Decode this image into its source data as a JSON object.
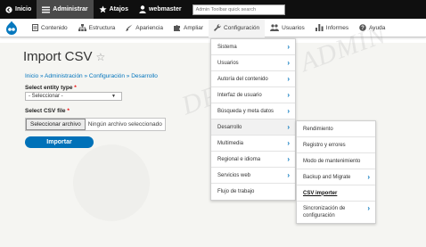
{
  "toolbar": {
    "home": "Inicio",
    "manage": "Administrar",
    "shortcuts": "Atajos",
    "user": "webmaster",
    "search_placeholder": "Admin Toolbar quick search"
  },
  "tray": {
    "items": [
      "Contenido",
      "Estructura",
      "Apariencia",
      "Ampliar",
      "Configuración",
      "Usuarios",
      "Informes",
      "Ayuda"
    ]
  },
  "page": {
    "title": "Import CSV",
    "breadcrumb": "Inicio » Administración » Configuración » Desarrollo",
    "entity_label": "Select entity type",
    "entity_value": "- Seleccionar -",
    "csv_label": "Select CSV file",
    "file_button": "Seleccionar archivo",
    "file_none": "Ningún archivo seleccionado",
    "submit": "Importar",
    "required_mark": "*"
  },
  "config_menu": [
    {
      "label": "Sistema",
      "has_children": true
    },
    {
      "label": "Usuarios",
      "has_children": true
    },
    {
      "label": "Autoría del contenido",
      "has_children": true
    },
    {
      "label": "Interfaz de usuario",
      "has_children": true
    },
    {
      "label": "Búsqueda y meta datos",
      "has_children": true
    },
    {
      "label": "Desarrollo",
      "has_children": true
    },
    {
      "label": "Multimedia",
      "has_children": true
    },
    {
      "label": "Regional e idioma",
      "has_children": true
    },
    {
      "label": "Servicios web",
      "has_children": true
    },
    {
      "label": "Flujo de trabajo",
      "has_children": false
    }
  ],
  "dev_menu": [
    {
      "label": "Rendimiento",
      "has_children": false
    },
    {
      "label": "Registro y errores",
      "has_children": false
    },
    {
      "label": "Modo de mantenimiento",
      "has_children": false
    },
    {
      "label": "Backup and Migrate",
      "has_children": true
    },
    {
      "label": "CSV importer",
      "has_children": false
    },
    {
      "label": "Sincronización de configuración",
      "has_children": true
    }
  ],
  "colors": {
    "toolbar_bg": "#0f0f0f",
    "accent": "#0071b8",
    "link": "#0074bd"
  }
}
